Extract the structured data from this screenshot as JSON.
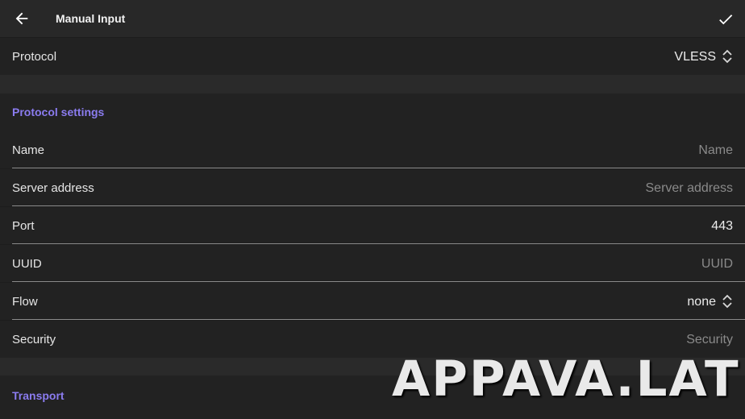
{
  "header": {
    "title": "Manual Input"
  },
  "protocol_row": {
    "label": "Protocol",
    "value": "VLESS"
  },
  "protocol_settings": {
    "title": "Protocol settings",
    "fields": [
      {
        "label": "Name",
        "value": "Name",
        "is_placeholder": true
      },
      {
        "label": "Server address",
        "value": "Server address",
        "is_placeholder": true
      },
      {
        "label": "Port",
        "value": "443",
        "is_placeholder": false
      },
      {
        "label": "UUID",
        "value": "UUID",
        "is_placeholder": true
      },
      {
        "label": "Flow",
        "value": "none",
        "is_placeholder": false
      },
      {
        "label": "Security",
        "value": "Security",
        "is_placeholder": true
      }
    ]
  },
  "transport": {
    "title": "Transport"
  },
  "watermark": "APPAVA.LAT",
  "colors": {
    "accent": "#8b7cf0",
    "background": "#1d1d1d",
    "row_background": "#222222",
    "topbar": "#282828",
    "placeholder": "#8a8a8a"
  },
  "icons": {
    "back": "back-arrow-icon",
    "confirm": "checkmark-icon",
    "selector": "chevron-up-down-icon"
  }
}
